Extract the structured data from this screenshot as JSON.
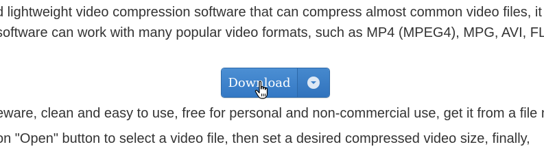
{
  "paragraphs": {
    "line1": "d lightweight video compression software that can compress almost common video files, it",
    "line2": "software can work with many popular video formats, such as MP4 (MPEG4), MPG, AVI, FL",
    "line3": "eware, clean and easy to use, free for personal and non-commercial use, get it from a file n",
    "line4": "on \"Open\" button to select a video file, then set a desired compressed video size, finally,"
  },
  "download_button": {
    "label": "Download",
    "dropdown_icon": "chevron-down-icon",
    "color": "#3a7fc8"
  },
  "cursor_icon": "hand-pointer-icon"
}
